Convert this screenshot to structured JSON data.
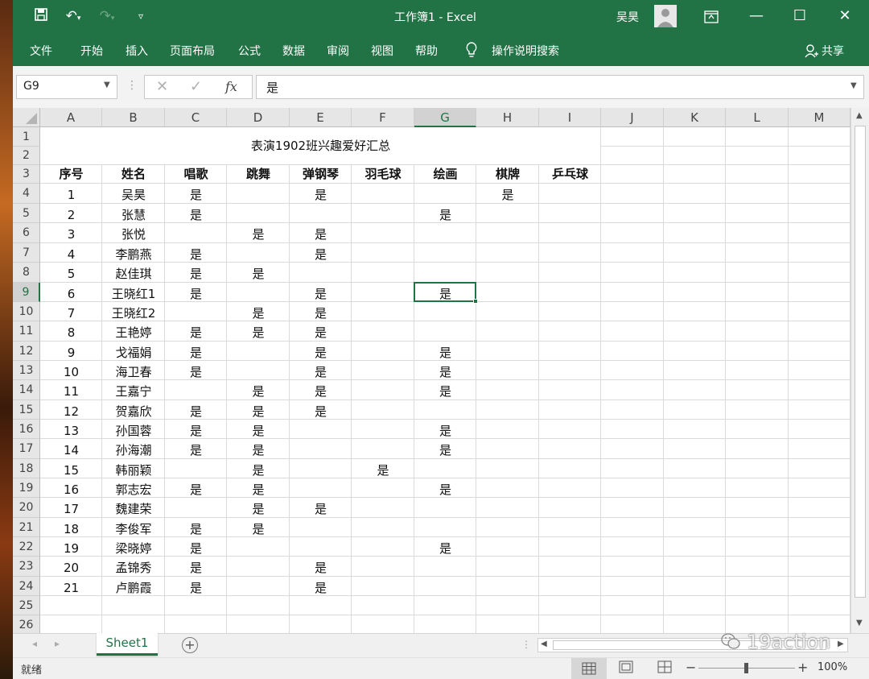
{
  "title_bar": {
    "title": "工作簿1  -  Excel",
    "user": "吴昊",
    "colors": {
      "excel_green": "#217346"
    }
  },
  "ribbon": {
    "tabs": [
      "文件",
      "开始",
      "插入",
      "页面布局",
      "公式",
      "数据",
      "审阅",
      "视图",
      "帮助"
    ],
    "tell_me": "操作说明搜索",
    "share": "共享"
  },
  "formula_bar": {
    "name_box": "G9",
    "fx": "fx",
    "value": "是"
  },
  "sheet": {
    "column_letters": [
      "A",
      "B",
      "C",
      "D",
      "E",
      "F",
      "G",
      "H",
      "I",
      "J",
      "K",
      "L",
      "M"
    ],
    "row_numbers": [
      "1",
      "2",
      "3",
      "4",
      "5",
      "6",
      "7",
      "8",
      "9",
      "10",
      "11",
      "12",
      "13",
      "14",
      "15",
      "16",
      "17",
      "18",
      "19",
      "20",
      "21",
      "22",
      "23",
      "24",
      "25",
      "26"
    ],
    "selected_cell": "G9",
    "title": "表演1902班兴趣爱好汇总",
    "headers": [
      "序号",
      "姓名",
      "唱歌",
      "跳舞",
      "弹钢琴",
      "羽毛球",
      "绘画",
      "棋牌",
      "乒乓球"
    ],
    "rows": [
      [
        "1",
        "吴昊",
        "是",
        "",
        "是",
        "",
        "",
        "是",
        ""
      ],
      [
        "2",
        "张慧",
        "是",
        "",
        "",
        "",
        "是",
        "",
        ""
      ],
      [
        "3",
        "张悦",
        "",
        "是",
        "是",
        "",
        "",
        "",
        ""
      ],
      [
        "4",
        "李鹏燕",
        "是",
        "",
        "是",
        "",
        "",
        "",
        ""
      ],
      [
        "5",
        "赵佳琪",
        "是",
        "是",
        "",
        "",
        "",
        "",
        ""
      ],
      [
        "6",
        "王晓红1",
        "是",
        "",
        "是",
        "",
        "是",
        "",
        ""
      ],
      [
        "7",
        "王晓红2",
        "",
        "是",
        "是",
        "",
        "",
        "",
        ""
      ],
      [
        "8",
        "王艳婷",
        "是",
        "是",
        "是",
        "",
        "",
        "",
        ""
      ],
      [
        "9",
        "戈福娟",
        "是",
        "",
        "是",
        "",
        "是",
        "",
        ""
      ],
      [
        "10",
        "海卫春",
        "是",
        "",
        "是",
        "",
        "是",
        "",
        ""
      ],
      [
        "11",
        "王嘉宁",
        "",
        "是",
        "是",
        "",
        "是",
        "",
        ""
      ],
      [
        "12",
        "贺嘉欣",
        "是",
        "是",
        "是",
        "",
        "",
        "",
        ""
      ],
      [
        "13",
        "孙国蓉",
        "是",
        "是",
        "",
        "",
        "是",
        "",
        ""
      ],
      [
        "14",
        "孙海潮",
        "是",
        "是",
        "",
        "",
        "是",
        "",
        ""
      ],
      [
        "15",
        "韩丽颖",
        "",
        "是",
        "",
        "是",
        "",
        "",
        ""
      ],
      [
        "16",
        "郭志宏",
        "是",
        "是",
        "",
        "",
        "是",
        "",
        ""
      ],
      [
        "17",
        "魏建荣",
        "",
        "是",
        "是",
        "",
        "",
        "",
        ""
      ],
      [
        "18",
        "李俊军",
        "是",
        "是",
        "",
        "",
        "",
        "",
        ""
      ],
      [
        "19",
        "梁晓婷",
        "是",
        "",
        "",
        "",
        "是",
        "",
        ""
      ],
      [
        "20",
        "孟锦秀",
        "是",
        "",
        "是",
        "",
        "",
        "",
        ""
      ],
      [
        "21",
        "卢鹏霞",
        "是",
        "",
        "是",
        "",
        "",
        "",
        ""
      ]
    ]
  },
  "sheet_tabs": {
    "active": "Sheet1",
    "add": "+"
  },
  "watermark": "19action",
  "status": {
    "ready": "就绪",
    "zoom": "100%",
    "minus": "−",
    "plus": "+"
  }
}
